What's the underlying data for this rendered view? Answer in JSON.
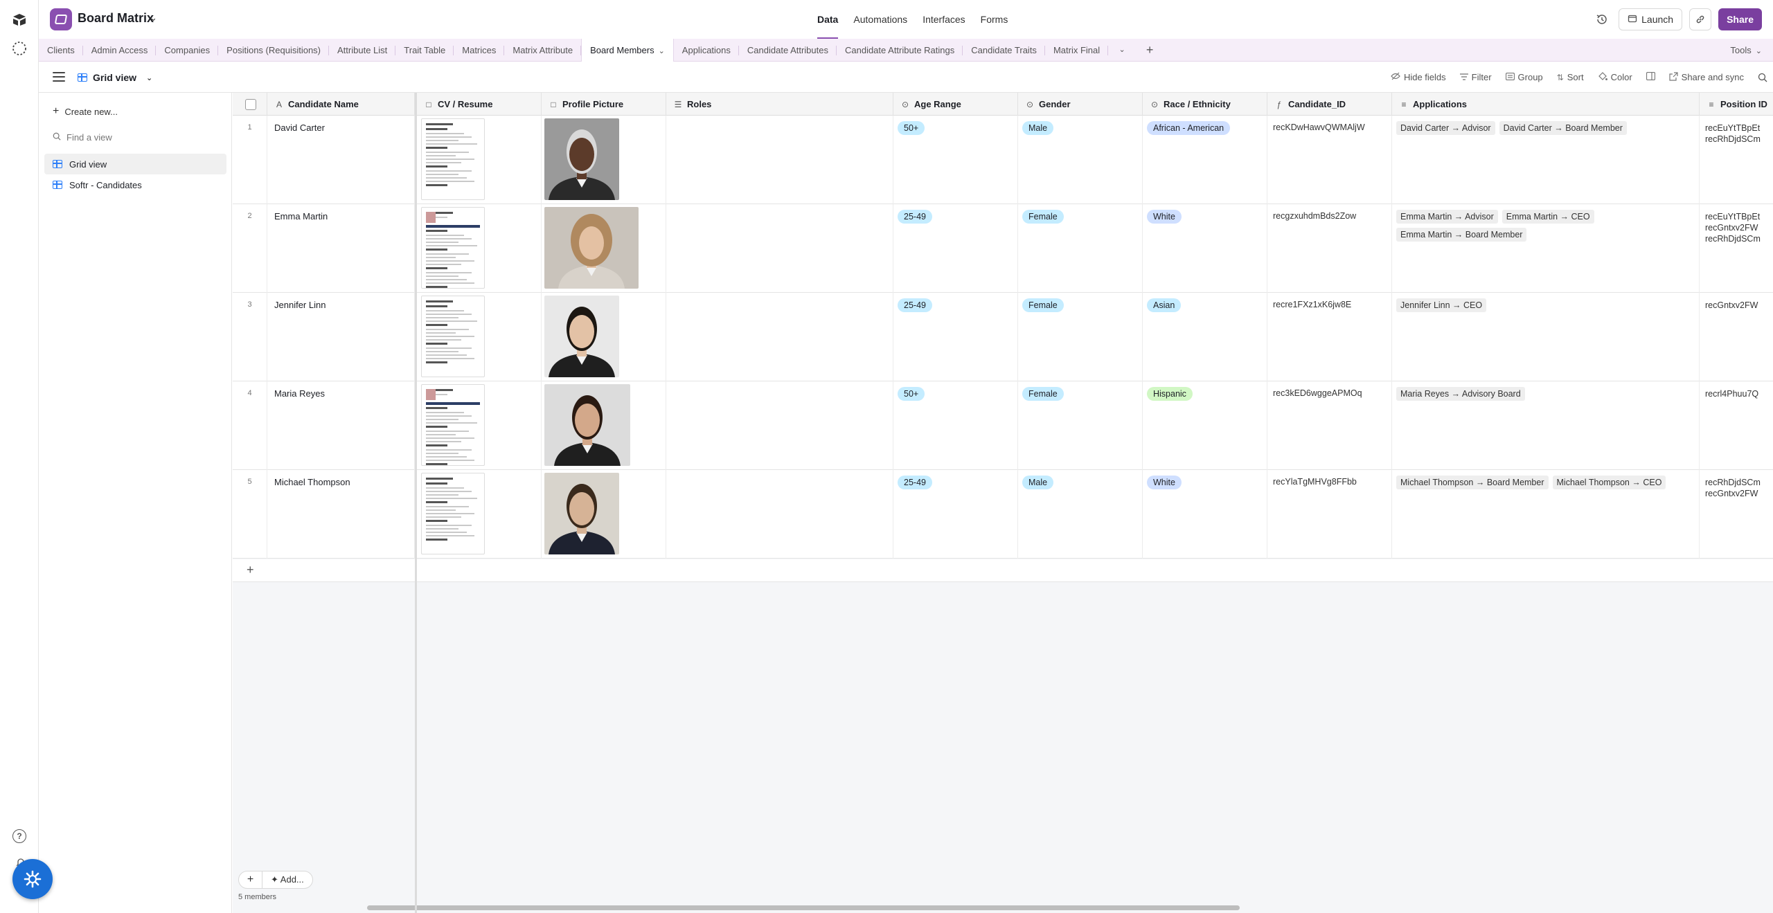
{
  "app": {
    "base_name": "Board Matrix",
    "nav": [
      "Data",
      "Automations",
      "Interfaces",
      "Forms"
    ],
    "active_nav": "Data",
    "launch_label": "Launch",
    "share_label": "Share",
    "accent": "#8a4fb0"
  },
  "tables": {
    "tabs": [
      "Clients",
      "Admin Access",
      "Companies",
      "Positions (Requisitions)",
      "Attribute List",
      "Trait Table",
      "Matrices",
      "Matrix Attribute",
      "Board Members",
      "Applications",
      "Candidate Attributes",
      "Candidate Attribute Ratings",
      "Candidate Traits",
      "Matrix Final"
    ],
    "active": "Board Members",
    "tools_label": "Tools"
  },
  "view": {
    "name": "Grid view",
    "toolbar": [
      "Hide fields",
      "Filter",
      "Group",
      "Sort",
      "Color",
      "Share and sync"
    ]
  },
  "sidebar": {
    "create_label": "Create new...",
    "find_placeholder": "Find a view",
    "views": [
      "Grid view",
      "Softr - Candidates"
    ]
  },
  "grid": {
    "columns": {
      "name": "Candidate Name",
      "cv": "CV / Resume",
      "pic": "Profile Picture",
      "roles": "Roles",
      "age": "Age Range",
      "gender": "Gender",
      "race": "Race / Ethnicity",
      "cid": "Candidate_ID",
      "apps": "Applications",
      "pos": "Position ID"
    },
    "rows": [
      {
        "num": "1",
        "name": "David Carter",
        "age": "50+",
        "gender": "Male",
        "race": "African - American",
        "race_color": "blue",
        "cid": "recKDwHawvQWMAljW",
        "apps": [
          "David Carter → Advisor",
          "David Carter → Board Member"
        ],
        "pos": [
          "recEuYtTBpEt",
          "recRhDjdSCm"
        ]
      },
      {
        "num": "2",
        "name": "Emma Martin",
        "age": "25-49",
        "gender": "Female",
        "race": "White",
        "race_color": "blue",
        "cid": "recgzxuhdmBds2Zow",
        "apps": [
          "Emma Martin → Advisor",
          "Emma Martin → CEO",
          "Emma Martin → Board Member"
        ],
        "pos": [
          "recEuYtTBpEt",
          "recGntxv2FW",
          "recRhDjdSCm"
        ]
      },
      {
        "num": "3",
        "name": "Jennifer Linn",
        "age": "25-49",
        "gender": "Female",
        "race": "Asian",
        "race_color": "cyan",
        "cid": "recre1FXz1xK6jw8E",
        "apps": [
          "Jennifer Linn → CEO"
        ],
        "pos": [
          "recGntxv2FW"
        ]
      },
      {
        "num": "4",
        "name": "Maria Reyes",
        "age": "50+",
        "gender": "Female",
        "race": "Hispanic",
        "race_color": "green",
        "cid": "rec3kED6wggeAPMOq",
        "apps": [
          "Maria Reyes → Advisory Board"
        ],
        "pos": [
          "recrl4Phuu7Q"
        ]
      },
      {
        "num": "5",
        "name": "Michael Thompson",
        "age": "25-49",
        "gender": "Male",
        "race": "White",
        "race_color": "blue",
        "cid": "recYlaTgMHVg8FFbb",
        "apps": [
          "Michael Thompson → Board Member",
          "Michael Thompson → CEO"
        ],
        "pos": [
          "recRhDjdSCm",
          "recGntxv2FW"
        ]
      }
    ],
    "add_label": "Add...",
    "record_count": "5 members"
  },
  "icons": {
    "history": "history-icon",
    "link": "link-icon",
    "help": "help-icon",
    "notifications": "bell-icon",
    "support": "support-fab-icon"
  }
}
